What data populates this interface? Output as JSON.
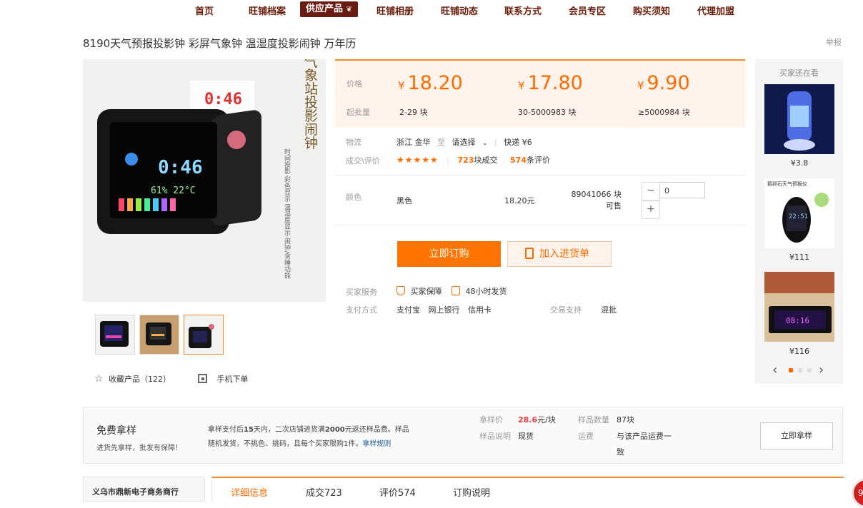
{
  "nav": {
    "items": [
      "首页",
      "旺铺档案",
      "供应产品",
      "旺铺相册",
      "旺铺动态",
      "联系方式",
      "会员专区",
      "购买须知",
      "代理加盟"
    ],
    "active": "供应产品"
  },
  "product": {
    "title": "8190天气预报投影钟 彩屏气象钟 温湿度投影闹钟 万年历",
    "report": "举报",
    "image_caption": "气象站投影闹钟",
    "image_side": "时间投影·彩色显示 温湿度显示·闹钟/贪睡功能",
    "image_time_top": "0:46",
    "image_time_screen": "0:46",
    "image_temp": "61% 22°C"
  },
  "price": {
    "label_price": "价格",
    "label_qty": "起批量",
    "tiers": [
      {
        "currency": "¥",
        "value": "18.20",
        "range": "2-29 块"
      },
      {
        "currency": "¥",
        "value": "17.80",
        "range": "30-5000983 块"
      },
      {
        "currency": "¥",
        "value": "9.90",
        "range": "≥5000984 块"
      }
    ]
  },
  "logistics": {
    "label": "物流",
    "from": "浙江 金华",
    "to_word": "至",
    "select": "请选择",
    "chevron": "chevron-down-icon",
    "express": "快递 ¥6"
  },
  "review": {
    "label": "成交\\评价",
    "stars": "★★★★★",
    "deals_num": "723",
    "deals_text": "块成交",
    "reviews_num": "574",
    "reviews_text": "条评价"
  },
  "sku": {
    "label": "颜色",
    "name": "黑色",
    "price": "18.20元",
    "stock": "89041066 块可售",
    "qty": "0",
    "minus": "−",
    "plus": "+"
  },
  "actions": {
    "buy": "立即订购",
    "cart": "加入进货单",
    "cart_icon": "clipboard-icon"
  },
  "service": {
    "label": "买家服务",
    "guarantee": "买家保障",
    "ship": "48小时发货",
    "pay_label": "支付方式",
    "pay_methods": [
      "支付宝",
      "网上银行",
      "信用卡"
    ],
    "trade_label": "交易支持",
    "trade_value": "混批"
  },
  "gallery": {
    "favorite_icon": "star-outline-icon",
    "favorite": "收藏产品（122）",
    "mobile_icon": "qrcode-icon",
    "mobile": "手机下单"
  },
  "side": {
    "title": "买家还在看",
    "items": [
      {
        "price": "¥3.8"
      },
      {
        "price": "¥111",
        "caption": "鹅卵石天气预报仪",
        "screen": "22:51"
      },
      {
        "price": "¥116",
        "screen": "08:16"
      }
    ],
    "prev": "‹",
    "next": "›"
  },
  "sample": {
    "title": "免费拿样",
    "subtitle": "进货先拿样，批发有保障！",
    "desc_1a": "拿样支付后",
    "desc_1b": "15",
    "desc_1c": "天内，二次店铺进货满",
    "desc_1d": "2000",
    "desc_1e": "元返还样品费。样品",
    "desc_2": "随机发货，不挑色、挑码，且每个买家限购1件。",
    "rule_link": "拿样规则",
    "price_label": "拿样价",
    "price_value": "28.6",
    "price_unit": "元/块",
    "qty_label": "样品数量",
    "qty_value": "87块",
    "note_label": "样品说明",
    "note_value": "现货",
    "freight_label": "运费",
    "freight_value": "与该产品运费一致",
    "button": "立即拿样"
  },
  "bottom": {
    "shop_name": "义乌市鼎新电子商务商行",
    "tabs": [
      "详细信息",
      "成交723",
      "评价574",
      "订购说明"
    ],
    "active_tab": "详细信息",
    "float_badge": "9"
  },
  "colors": {
    "accent": "#ff6a00",
    "nav_text": "#6b1d0b",
    "nav_active_bg": "#6a1b12",
    "link": "#1d5d99"
  }
}
